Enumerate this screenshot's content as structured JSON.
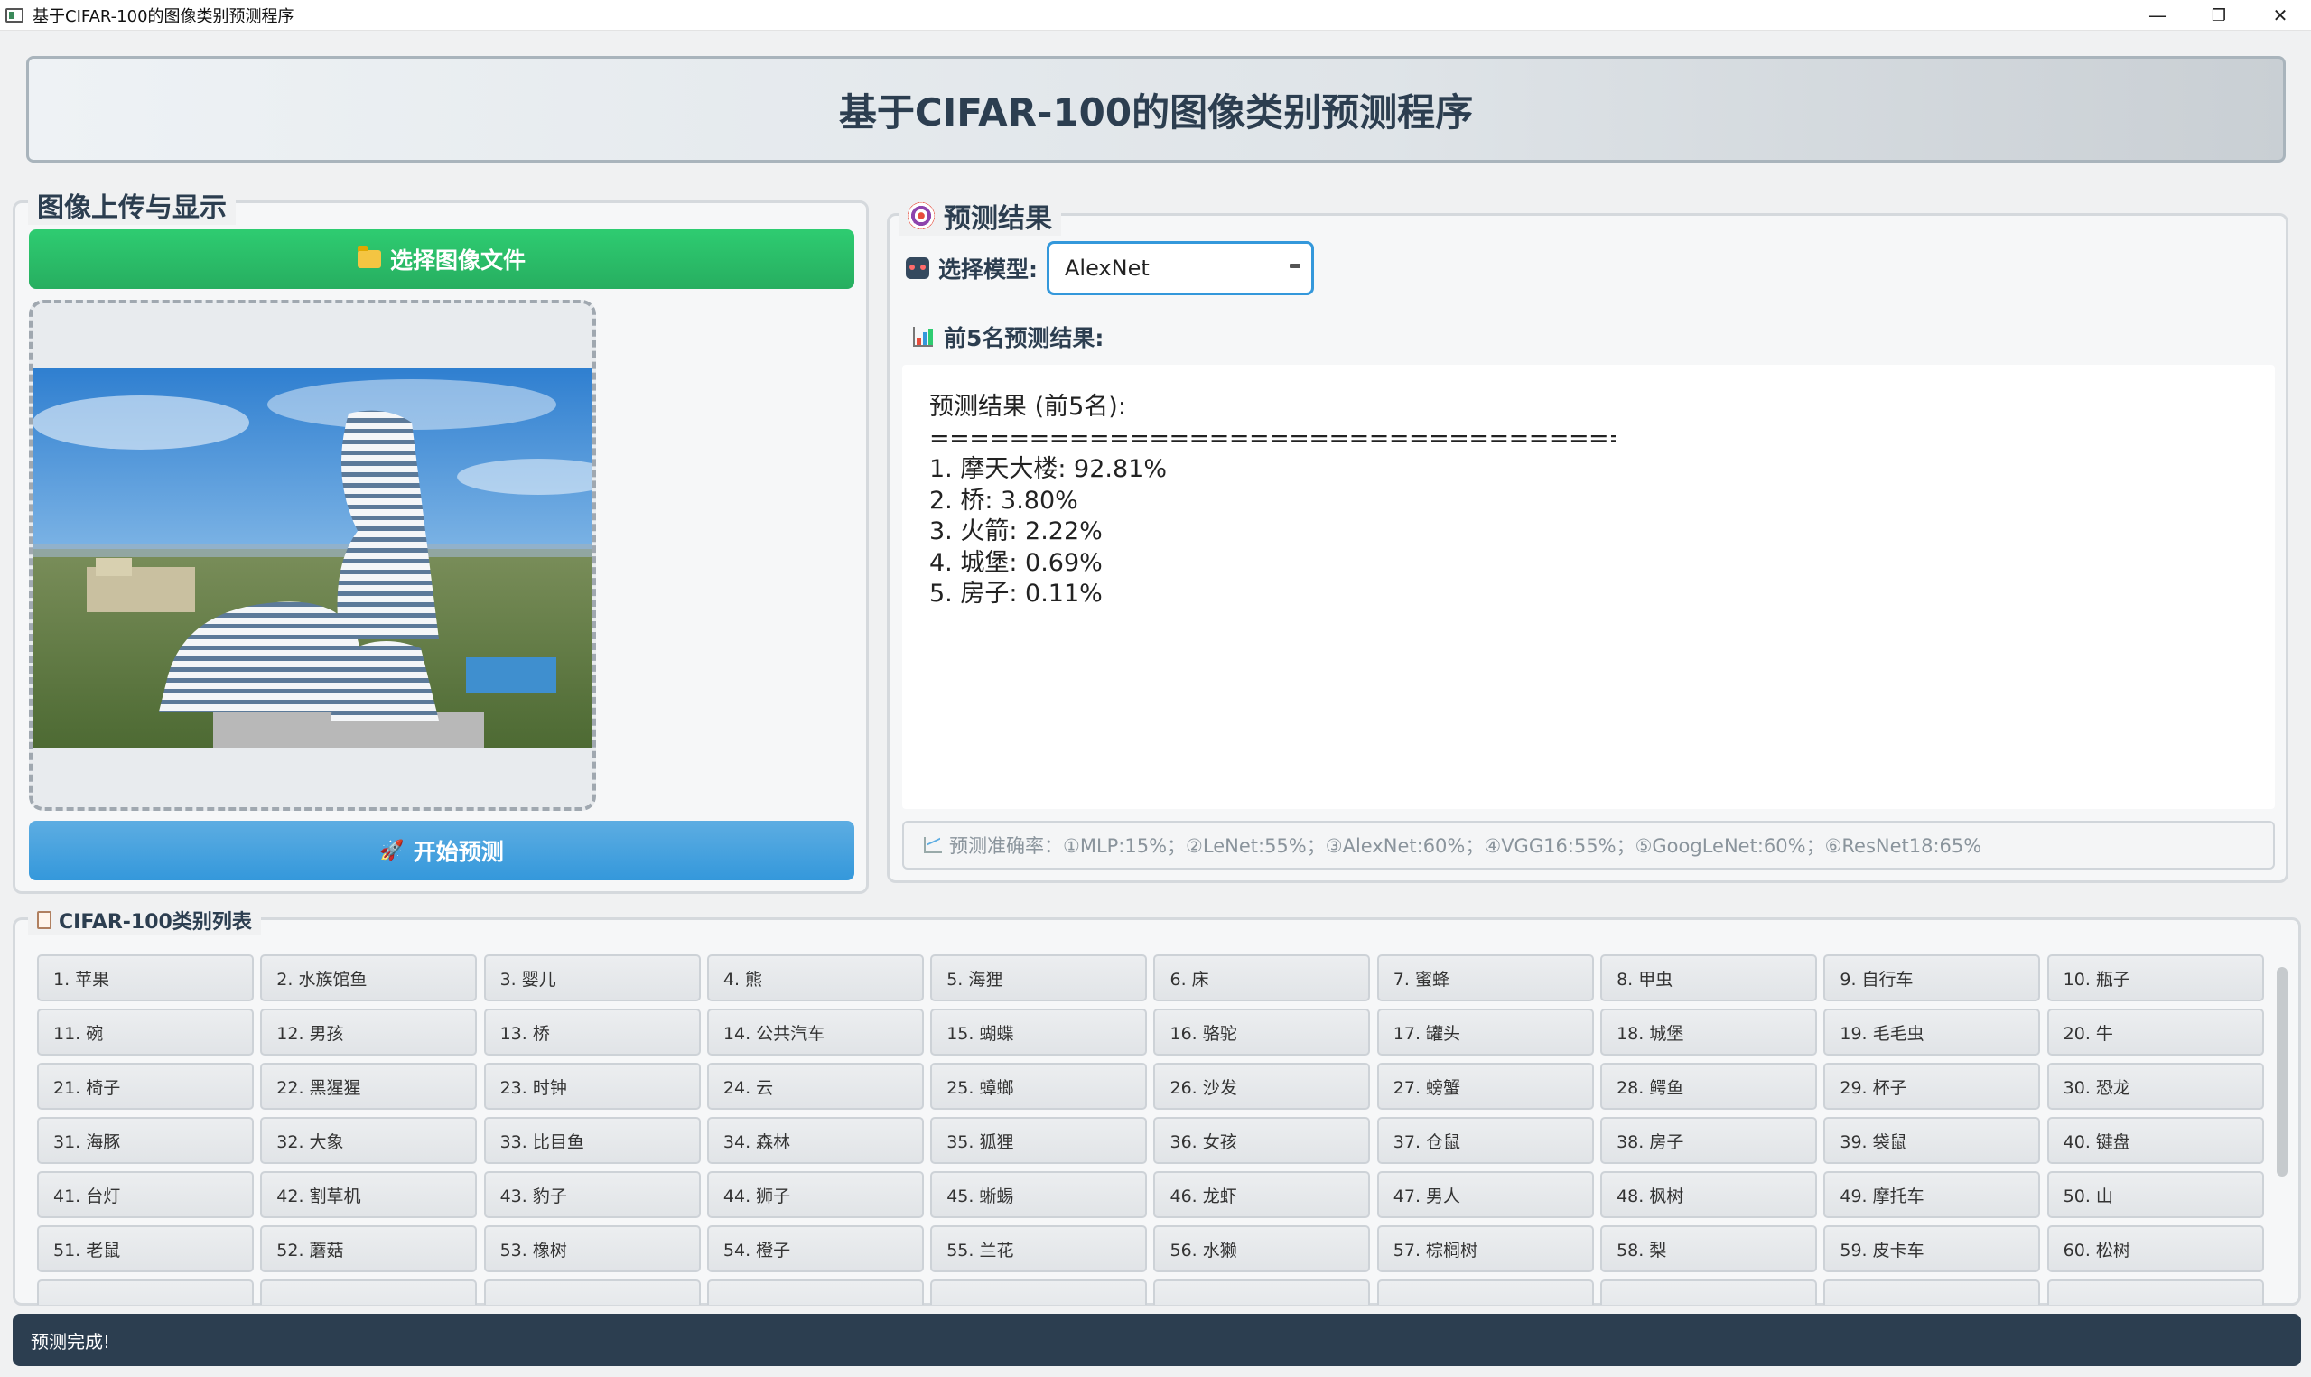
{
  "window": {
    "title": "基于CIFAR-100的图像类别预测程序",
    "minimize": "—",
    "maximize": "❐",
    "close": "✕"
  },
  "header": {
    "title": "基于CIFAR-100的图像类别预测程序"
  },
  "upload_panel": {
    "title": "图像上传与显示",
    "select_button": "选择图像文件",
    "predict_button": "开始预测"
  },
  "result_panel": {
    "title": "预测结果",
    "model_label": "选择模型:",
    "model_value": "AlexNet",
    "top5_label": "前5名预测结果:",
    "results_heading": "预测结果 (前5名):",
    "separator": "========================================",
    "results": [
      "1. 摩天大楼: 92.81%",
      "2. 桥: 3.80%",
      "3. 火箭: 2.22%",
      "4. 城堡: 0.69%",
      "5. 房子: 0.11%"
    ],
    "accuracy_text": "预测准确率：①MLP:15%；②LeNet:55%；③AlexNet:60%；④VGG16:55%；⑤GoogLeNet:60%；⑥ResNet18:65%"
  },
  "category_panel": {
    "title": "CIFAR-100类别列表",
    "items": [
      "1. 苹果",
      "2. 水族馆鱼",
      "3. 婴儿",
      "4. 熊",
      "5. 海狸",
      "6. 床",
      "7. 蜜蜂",
      "8. 甲虫",
      "9. 自行车",
      "10. 瓶子",
      "11. 碗",
      "12. 男孩",
      "13. 桥",
      "14. 公共汽车",
      "15. 蝴蝶",
      "16. 骆驼",
      "17. 罐头",
      "18. 城堡",
      "19. 毛毛虫",
      "20. 牛",
      "21. 椅子",
      "22. 黑猩猩",
      "23. 时钟",
      "24. 云",
      "25. 蟑螂",
      "26. 沙发",
      "27. 螃蟹",
      "28. 鳄鱼",
      "29. 杯子",
      "30. 恐龙",
      "31. 海豚",
      "32. 大象",
      "33. 比目鱼",
      "34. 森林",
      "35. 狐狸",
      "36. 女孩",
      "37. 仓鼠",
      "38. 房子",
      "39. 袋鼠",
      "40. 键盘",
      "41. 台灯",
      "42. 割草机",
      "43. 豹子",
      "44. 狮子",
      "45. 蜥蜴",
      "46. 龙虾",
      "47. 男人",
      "48. 枫树",
      "49. 摩托车",
      "50. 山",
      "51. 老鼠",
      "52. 蘑菇",
      "53. 橡树",
      "54. 橙子",
      "55. 兰花",
      "56. 水獭",
      "57. 棕榈树",
      "58. 梨",
      "59. 皮卡车",
      "60. 松树",
      "",
      "",
      "",
      "",
      "",
      "",
      "",
      "",
      "",
      ""
    ]
  },
  "status_bar": {
    "text": "预测完成!"
  }
}
